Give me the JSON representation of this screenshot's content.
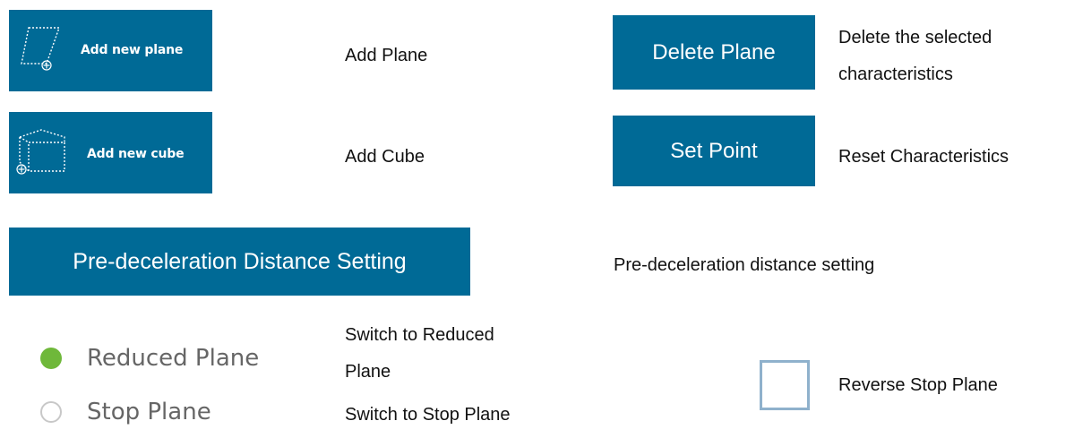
{
  "buttons": {
    "add_plane": {
      "label": "Add new plane",
      "icon": "plane-add-icon"
    },
    "add_cube": {
      "label": "Add new cube",
      "icon": "cube-add-icon"
    },
    "delete_plane": {
      "label": "Delete Plane"
    },
    "set_point": {
      "label": "Set Point"
    },
    "pre_decel": {
      "label": "Pre-deceleration Distance Setting"
    }
  },
  "descriptions": {
    "add_plane": "Add Plane",
    "add_cube": "Add Cube",
    "delete_plane_line1": "Delete the selected",
    "delete_plane_line2": "characteristics",
    "set_point": "Reset Characteristics",
    "pre_decel": "Pre-deceleration distance setting",
    "reduced_plane_line1": "Switch to Reduced",
    "reduced_plane_line2": "Plane",
    "stop_plane": "Switch to Stop Plane",
    "reverse_stop": "Reverse Stop Plane"
  },
  "radios": {
    "reduced_plane": {
      "label": "Reduced Plane",
      "selected": true
    },
    "stop_plane": {
      "label": "Stop Plane",
      "selected": false
    }
  },
  "checkbox": {
    "checked": false
  },
  "colors": {
    "button_bg": "#006a96",
    "radio_selected": "#6fb83a",
    "radio_unselected_border": "#c8c8c8",
    "checkbox_border": "#8fb1cc"
  }
}
